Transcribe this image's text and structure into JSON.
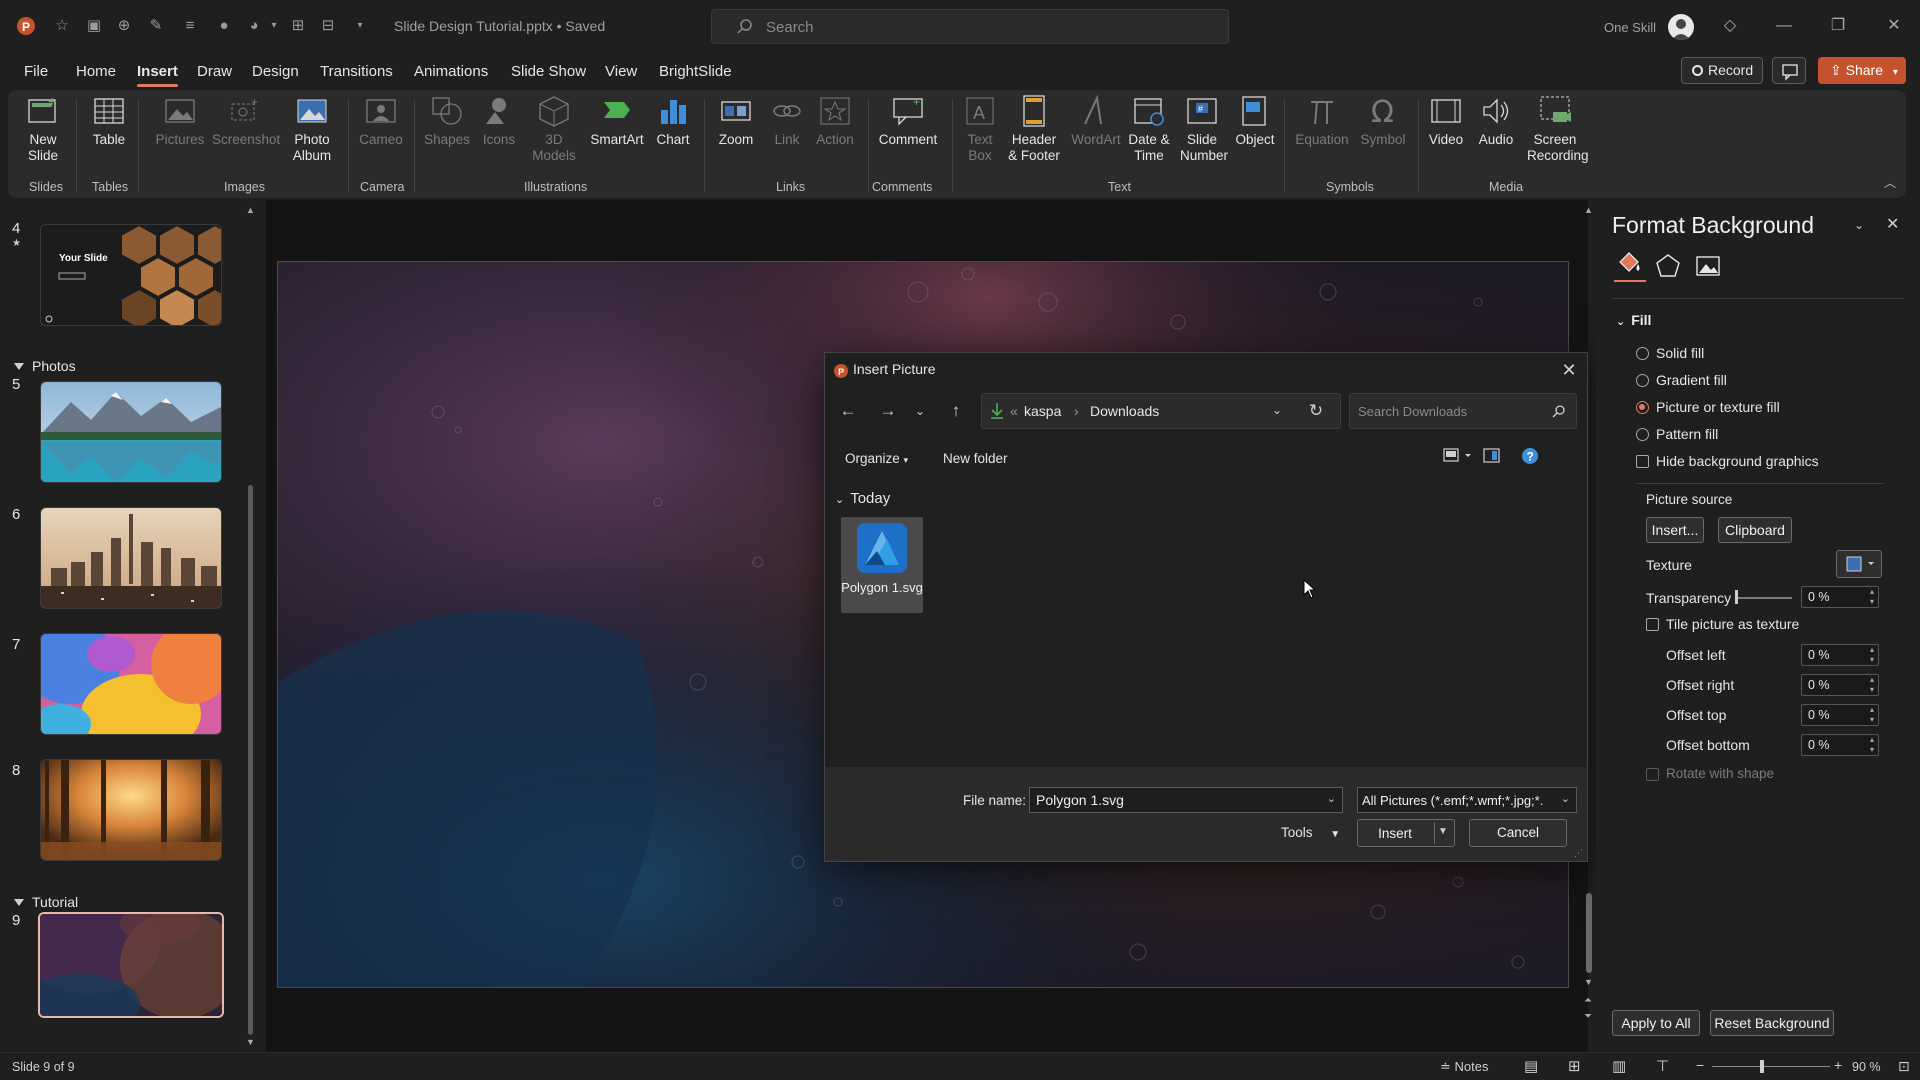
{
  "app": {
    "doc_title": "Slide Design Tutorial.pptx • Saved",
    "search_placeholder": "Search",
    "user_name": "One Skill",
    "accent": "#e07a5f"
  },
  "menu": {
    "tabs": [
      "File",
      "Home",
      "Insert",
      "Draw",
      "Design",
      "Transitions",
      "Animations",
      "Slide Show",
      "View",
      "BrightSlide"
    ],
    "active": "Insert",
    "record_label": "Record",
    "share_label": "Share"
  },
  "ribbon": {
    "new_slide": "New Slide",
    "table": "Table",
    "pictures": "Pictures",
    "screenshot": "Screenshot",
    "photo_album": "Photo Album",
    "cameo": "Cameo",
    "shapes": "Shapes",
    "icons": "Icons",
    "models_3d": "3D Models",
    "smartart": "SmartArt",
    "chart": "Chart",
    "zoom": "Zoom",
    "link": "Link",
    "action": "Action",
    "comment": "Comment",
    "text_box": "Text Box",
    "header_footer": "Header & Footer",
    "wordart": "WordArt",
    "date_time": "Date & Time",
    "slide_number": "Slide Number",
    "object": "Object",
    "equation": "Equation",
    "symbol": "Symbol",
    "video": "Video",
    "audio": "Audio",
    "screen_recording": "Screen Recording",
    "groups": {
      "slides": "Slides",
      "tables": "Tables",
      "images": "Images",
      "camera": "Camera",
      "illustrations": "Illustrations",
      "links": "Links",
      "comments": "Comments",
      "text": "Text",
      "symbols": "Symbols",
      "media": "Media"
    }
  },
  "slides_panel": {
    "sections": {
      "photos": "Photos",
      "tutorial": "Tutorial"
    },
    "numbers": [
      "4",
      "5",
      "6",
      "7",
      "8",
      "9"
    ],
    "slide4_text": "Your Slide"
  },
  "dialog": {
    "title": "Insert Picture",
    "path": [
      "kaspa",
      "Downloads"
    ],
    "search_placeholder": "Search Downloads",
    "organize": "Organize",
    "new_folder": "New folder",
    "group_today": "Today",
    "file_name_label": "File name:",
    "file_item": "Polygon 1.svg",
    "file_name_value": "Polygon 1.svg",
    "file_type": "All Pictures (*.emf;*.wmf;*.jpg;*.",
    "tools": "Tools",
    "insert": "Insert",
    "cancel": "Cancel"
  },
  "format_pane": {
    "title": "Format Background",
    "section_fill": "Fill",
    "fill_options": [
      "Solid fill",
      "Gradient fill",
      "Picture or texture fill",
      "Pattern fill"
    ],
    "selected_fill": "Picture or texture fill",
    "hide_bg": "Hide background graphics",
    "picture_source": "Picture source",
    "insert_btn": "Insert...",
    "clipboard_btn": "Clipboard",
    "texture": "Texture",
    "transparency": "Transparency",
    "transparency_value": "0 %",
    "tile": "Tile picture as texture",
    "offsets": [
      {
        "label": "Offset left",
        "value": "0 %"
      },
      {
        "label": "Offset right",
        "value": "0 %"
      },
      {
        "label": "Offset top",
        "value": "0 %"
      },
      {
        "label": "Offset bottom",
        "value": "0 %"
      }
    ],
    "rotate": "Rotate with shape",
    "apply_all": "Apply to All",
    "reset": "Reset Background"
  },
  "status": {
    "slide_of": "Slide 9 of 9",
    "notes": "Notes",
    "zoom": "90 %"
  }
}
